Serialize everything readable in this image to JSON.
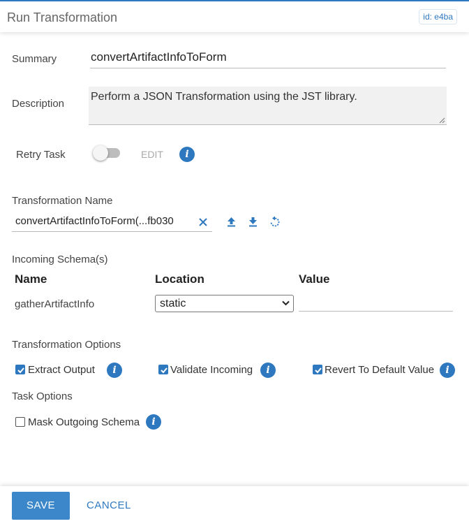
{
  "header": {
    "title": "Run Transformation",
    "id_badge": "id: e4ba"
  },
  "form": {
    "summary_label": "Summary",
    "summary_value": "convertArtifactInfoToForm",
    "description_label": "Description",
    "description_value": "Perform a JSON Transformation using the JST library.",
    "retry_label": "Retry Task",
    "retry_enabled": false,
    "edit_label": "EDIT"
  },
  "transformation": {
    "name_label": "Transformation Name",
    "name_value": "convertArtifactInfoToForm(...fb030"
  },
  "incoming": {
    "section_label": "Incoming Schema(s)",
    "columns": [
      "Name",
      "Location",
      "Value"
    ],
    "rows": [
      {
        "name": "gatherArtifactInfo",
        "location": "static",
        "value": ""
      }
    ]
  },
  "options": {
    "section_label": "Transformation Options",
    "extract_output": "Extract Output",
    "validate_incoming": "Validate Incoming",
    "revert_default": "Revert To Default Value"
  },
  "task_options": {
    "section_label": "Task Options",
    "mask_outgoing": "Mask Outgoing Schema"
  },
  "footer": {
    "save": "SAVE",
    "cancel": "CANCEL"
  },
  "colors": {
    "accent": "#2e78c0",
    "save_bg": "#3b87c9"
  },
  "icons": [
    "info-icon",
    "clear-icon",
    "upload-icon",
    "download-icon",
    "reset-icon",
    "chevron-down-icon",
    "checkbox-icon"
  ]
}
